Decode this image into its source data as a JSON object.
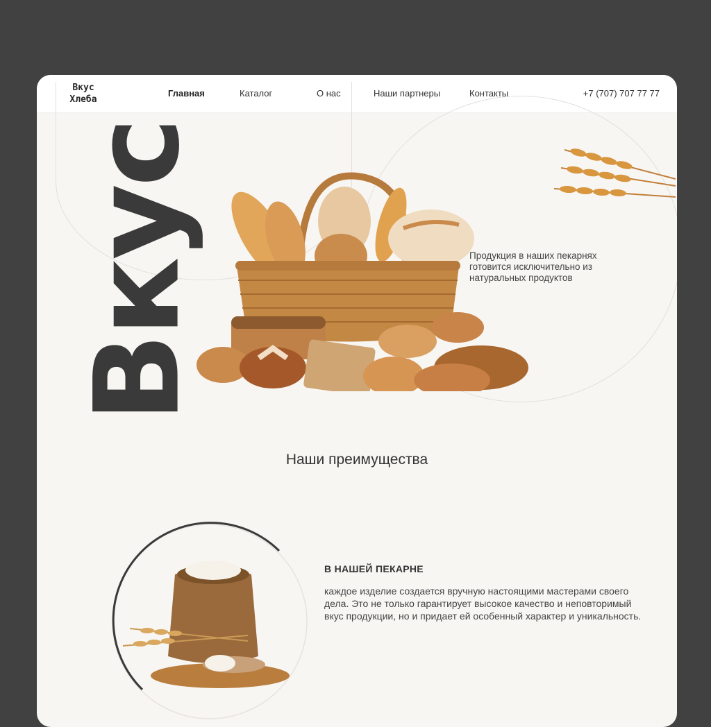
{
  "header": {
    "logo": {
      "line1": "Вкус",
      "line2": "Хлеба"
    },
    "nav": [
      {
        "label": "Главная",
        "active": true
      },
      {
        "label": "Каталог",
        "active": false
      },
      {
        "label": "О нас",
        "active": false
      },
      {
        "label": "Наши партнеры",
        "active": false
      },
      {
        "label": "Контакты",
        "active": false
      }
    ],
    "phone": "+7 (707) 707 77 77"
  },
  "hero": {
    "big_word": "Вкус",
    "description": "Продукция в наших пекарнях готовится исключительно из натуральных продуктов"
  },
  "advantages": {
    "section_title": "Наши преимущества",
    "items": [
      {
        "title": "В НАШЕЙ ПЕКАРНЕ",
        "text": "каждое изделие создается вручную настоящими мастерами своего дела. Это не только гарантирует высокое качество и неповторимый вкус продукции, но и придает ей особенный характер и уникальность."
      }
    ]
  },
  "icons": [
    "bread-basket-image",
    "wheat-ears-image",
    "flour-sack-image"
  ],
  "colors": {
    "page_bg": "#414141",
    "card_bg": "#f8f6f3",
    "text_dark": "#333333",
    "bread": "#c98a4b"
  }
}
